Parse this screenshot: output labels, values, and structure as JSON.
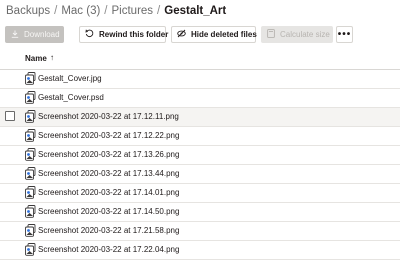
{
  "breadcrumb": {
    "items": [
      "Backups",
      "Mac (3)",
      "Pictures"
    ],
    "separator": "/",
    "current": "Gestalt_Art"
  },
  "toolbar": {
    "download_label": "Download",
    "rewind_label": "Rewind this folder",
    "hide_deleted_label": "Hide deleted files",
    "calculate_size_label": "Calculate size",
    "more_label": "•••"
  },
  "table": {
    "name_header": "Name",
    "sort_indicator": "↑",
    "rows": [
      {
        "name": "Gestalt_Cover.jpg",
        "icon": "image-file-icon"
      },
      {
        "name": "Gestalt_Cover.psd",
        "icon": "image-file-icon"
      },
      {
        "name": "Screenshot 2020-03-22 at 17.12.11.png",
        "icon": "image-file-icon"
      },
      {
        "name": "Screenshot 2020-03-22 at 17.12.22.png",
        "icon": "image-file-icon"
      },
      {
        "name": "Screenshot 2020-03-22 at 17.13.26.png",
        "icon": "image-file-icon"
      },
      {
        "name": "Screenshot 2020-03-22 at 17.13.44.png",
        "icon": "image-file-icon"
      },
      {
        "name": "Screenshot 2020-03-22 at 17.14.01.png",
        "icon": "image-file-icon"
      },
      {
        "name": "Screenshot 2020-03-22 at 17.14.50.png",
        "icon": "image-file-icon"
      },
      {
        "name": "Screenshot 2020-03-22 at 17.21.58.png",
        "icon": "image-file-icon"
      },
      {
        "name": "Screenshot 2020-03-22 at 17.22.04.png",
        "icon": "image-file-icon"
      }
    ]
  },
  "colors": {
    "accent": "#1e1919",
    "disabled_button": "#c4c2bf",
    "row_hover": "#f5f4f2"
  }
}
